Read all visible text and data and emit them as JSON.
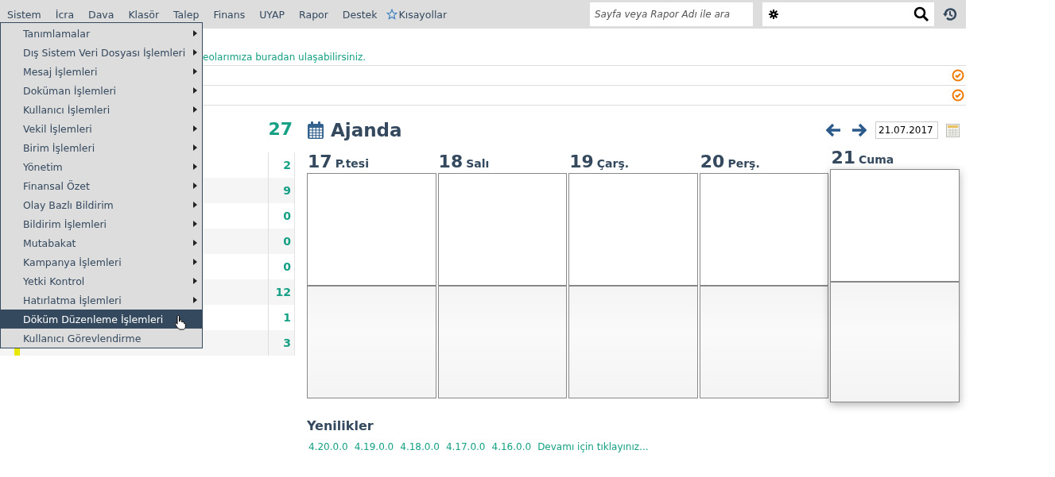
{
  "menubar": {
    "items": [
      {
        "label": "Sistem"
      },
      {
        "label": "İcra"
      },
      {
        "label": "Dava"
      },
      {
        "label": "Klasör"
      },
      {
        "label": "Talep"
      },
      {
        "label": "Finans"
      },
      {
        "label": "UYAP"
      },
      {
        "label": "Rapor"
      },
      {
        "label": "Destek"
      }
    ],
    "shortcuts": "Kısayollar",
    "search": {
      "placeholder": "Sayfa veya Rapor Adı ile ara"
    }
  },
  "dropdown": {
    "items": [
      {
        "label": "Tanımlamalar",
        "submenu": true,
        "selected": false
      },
      {
        "label": "Dış Sistem Veri Dosyası İşlemleri",
        "submenu": true,
        "selected": false
      },
      {
        "label": "Mesaj İşlemleri",
        "submenu": true,
        "selected": false
      },
      {
        "label": "Doküman İşlemleri",
        "submenu": true,
        "selected": false
      },
      {
        "label": "Kullanıcı İşlemleri",
        "submenu": true,
        "selected": false
      },
      {
        "label": "Vekil İşlemleri",
        "submenu": true,
        "selected": false
      },
      {
        "label": "Birim İşlemleri",
        "submenu": true,
        "selected": false
      },
      {
        "label": "Yönetim",
        "submenu": true,
        "selected": false
      },
      {
        "label": "Finansal Özet",
        "submenu": true,
        "selected": false
      },
      {
        "label": "Olay Bazlı Bildirim",
        "submenu": true,
        "selected": false
      },
      {
        "label": "Bildirim İşlemleri",
        "submenu": true,
        "selected": false
      },
      {
        "label": "Mutabakat",
        "submenu": true,
        "selected": false
      },
      {
        "label": "Kampanya İşlemleri",
        "submenu": true,
        "selected": false
      },
      {
        "label": "Yetki Kontrol",
        "submenu": true,
        "selected": false
      },
      {
        "label": "Hatırlatma İşlemleri",
        "submenu": true,
        "selected": false
      },
      {
        "label": "Döküm Düzenleme İşlemleri",
        "submenu": false,
        "selected": true
      },
      {
        "label": "Kullanıcı Görevlendirme",
        "submenu": false,
        "selected": false
      }
    ]
  },
  "notice": "eolarımıza buradan ulaşabilirsiniz.",
  "summary": {
    "total": "27",
    "counts": [
      "2",
      "9",
      "0",
      "0",
      "0",
      "12",
      "1",
      "3"
    ]
  },
  "agenda": {
    "title": "Ajanda",
    "date": "21.07.2017",
    "days": [
      {
        "number": "17",
        "name": "P.tesi",
        "selected": false
      },
      {
        "number": "18",
        "name": "Salı",
        "selected": false
      },
      {
        "number": "19",
        "name": "Çarş.",
        "selected": false
      },
      {
        "number": "20",
        "name": "Perş.",
        "selected": false
      },
      {
        "number": "21",
        "name": "Cuma",
        "selected": true
      }
    ]
  },
  "news": {
    "title": "Yenilikler",
    "links": [
      "4.20.0.0",
      "4.19.0.0",
      "4.18.0.0",
      "4.17.0.0",
      "4.16.0.0",
      "Devamı için tıklayınız..."
    ]
  }
}
